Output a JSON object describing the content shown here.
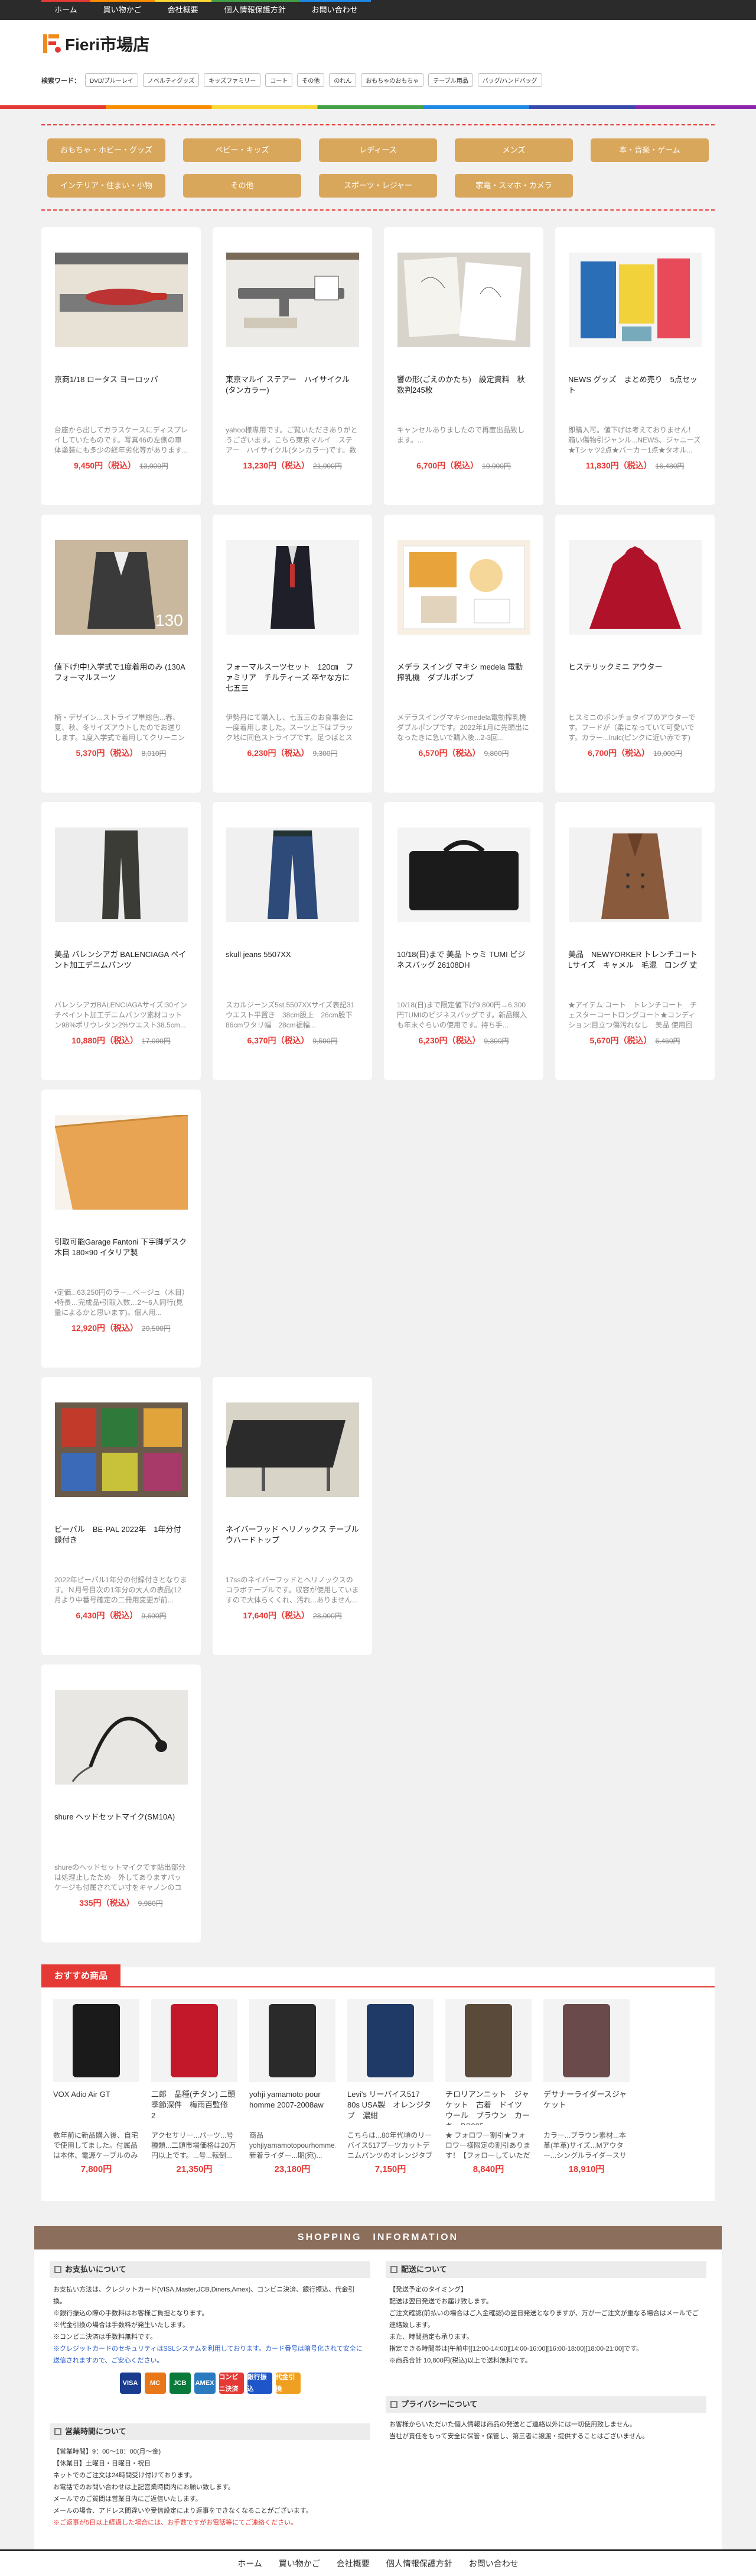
{
  "nav": {
    "items": [
      "ホーム",
      "買い物かご",
      "会社概要",
      "個人情報保護方針",
      "お問い合わせ"
    ],
    "colors": [
      "#e53935",
      "#fb8c00",
      "#fdd835",
      "#43a047",
      "#1e88e5"
    ]
  },
  "header": {
    "logo_text": "Fieri市場店",
    "keyword_label": "検索ワード：",
    "keywords": [
      "DVD/ブルーレイ",
      "ノベルティグッズ",
      "キッズファミリー",
      "コート",
      "その他",
      "のれん",
      "おもちゃのおもちゃ",
      "テーブル用品",
      "バッグ/ハンドバッグ"
    ]
  },
  "categories": [
    "おもちゃ・ホビー・グッズ",
    "ベビー・キッズ",
    "レディース",
    "メンズ",
    "本・音楽・ゲーム",
    "インテリア・住まい・小物",
    "その他",
    "スポーツ・レジャー",
    "家電・スマホ・カメラ"
  ],
  "products": [
    {
      "name": "京商1/18 ロータス ヨーロッパ",
      "desc": "台座から出してガラスケースにディスプレイしていたものです。写真46の左側の車体塗装にも多少の経年劣化等があります...",
      "price": "9,450円（税込）",
      "old": "13,000円",
      "img": "model-car",
      "c1": "#b33",
      "c2": "#e8e2d6"
    },
    {
      "name": "東京マルイ ステアー　ハイサイクル(タンカラー)",
      "desc": "yahoo様専用です。ご覧いただきありがとうございます。こちら東京マルイ　ステアー　ハイサイクル(タンカラー)です。数年...",
      "price": "13,230円（税込）",
      "old": "21,000円",
      "img": "airsoft",
      "c1": "#6b6b6b",
      "c2": "#eceae6"
    },
    {
      "name": "響の形(ごえのかたち)　設定資料　秋数判245枚",
      "desc": "キャンセルありましたので再度出品致します。...",
      "price": "6,700円（税込）",
      "old": "10,000円",
      "img": "papers",
      "c1": "#f5f3ee",
      "c2": "#d8d4cc"
    },
    {
      "name": "NEWS グッズ　まとめ売り　5点セット",
      "desc": "即購入可。値下げは考えておりません！箱い傷物引ジャンル...NEWS、ジャニーズ★Tシャツ2点★パーカー1点★タオル...",
      "price": "11,830円（税込）",
      "old": "16,480円",
      "img": "goods",
      "c1": "#2a6eb8",
      "c2": "#f2d23a"
    },
    {
      "name": "値下げ!中!入学式で1度着用のみ (130Aフォーマルスーツ",
      "desc": "柄・デザイン...ストライプ単総色...春、夏、秋、冬サイズアウトしたのでお送りします。1度入学式で着用してクリーニング済み...",
      "price": "5,370円（税込）",
      "old": "8,010円",
      "img": "suit-130",
      "c1": "#3a3a3a",
      "c2": "#c9b89e"
    },
    {
      "name": "フォーマルスーツセット　120㎝　ファミリア　チルティーズ 卒ヤな方に　七五三",
      "desc": "伊勢丹にて購入し、七五三のお食事会に一度着用しました。スーツ上下はブラック地に同色ストライプです。足つばとスーツ...",
      "price": "6,230円（税込）",
      "old": "9,300円",
      "img": "kids-suit",
      "c1": "#1f1f2a",
      "c2": "#f4f4f4"
    },
    {
      "name": "メデラ スイング マキシ medela 電動搾乳機　ダブルポンプ",
      "desc": "メデラスイングマキシmedela電動搾乳機　ダブルポンプです。2022年1月に先頭出になったきに急いで購入後...2-3回...",
      "price": "6,570円（税込）",
      "old": "9,800円",
      "img": "pump",
      "c1": "#e8a43a",
      "c2": "#f7efe2"
    },
    {
      "name": "ヒステリックミニ アウター",
      "desc": "ヒスミニのポンチョタイプのアウターです。フードが（柔になっていて可愛いです。カラー...lrulc(ピンクに近い赤です)",
      "price": "6,700円（税込）",
      "old": "10,000円",
      "img": "red-coat",
      "c1": "#b0122a",
      "c2": "#f4f4f4"
    },
    {
      "name": "美品 バレンシアガ BALENCIAGA ペイント加工デニムパンツ",
      "desc": "バレンシアガBALENCIAGAサイズ:30インチペイント加工デニムパンツ素材コットン98%ポリウレタン2%ウエスト38.5cm...",
      "price": "10,880円（税込）",
      "old": "17,000円",
      "img": "pants-dark",
      "c1": "#3c3c36",
      "c2": "#ededed"
    },
    {
      "name": "skull jeans 5507XX",
      "desc": "スカルジーンズ5st.5507XXサイズ表記31ウエスト平置き　38cm股上　26cm股下　86cmワタリ幅　28cm裾幅...",
      "price": "6,370円（税込）",
      "old": "9,500円",
      "img": "jeans",
      "c1": "#2e4a78",
      "c2": "#f0f0f0"
    },
    {
      "name": "10/18(日)まで 美品 トゥミ TUMI ビジネスバッグ 26108DH",
      "desc": "10/18(日)まで限定値下げ9,800円→6,300円TUMIのビジネスバッグです。新品購入も年末ぐらいの使用です。持ち手...",
      "price": "6,230円（税込）",
      "old": "9,300円",
      "img": "bag",
      "c1": "#1b1b1b",
      "c2": "#f3f3f3"
    },
    {
      "name": "美品　NEWYORKER トレンチコート Lサイズ　キャメル　毛混　ロング 丈",
      "desc": "★アイテム:コート　トレンチコート　チェスターコートロングコート★コンディション:目立つ傷汚れなし　美品 使用回数...",
      "price": "5,670円（税込）",
      "old": "6,460円",
      "img": "trench",
      "c1": "#8a5a3c",
      "c2": "#f2f2f2"
    },
    {
      "name": "引取可能Garage Fantoni 下宇脚デスク 木目 180×90 イタリア製",
      "desc": "•定価...63,250円のラー...ページュ（木目）•特長…完成品•引取入数…2〜6人同行(見量によるかと思います)。個人用...",
      "price": "12,920円（税込）",
      "old": "20,500円",
      "img": "desk",
      "c1": "#e8a452",
      "c2": "#f7f3ec"
    },
    {
      "name": "ビーパル　BE-PAL 2022年　1年分付録付き",
      "desc": "2022年ビーパル1年分の付録付きとなります。Ｎ月号目次の1年分の大人の表品(12月より中番号確定の二冊用変更が前...",
      "price": "6,430円（税込）",
      "old": "9,600円",
      "img": "magazines",
      "c1": "#c23a2a",
      "c2": "#2f7a3a"
    },
    {
      "name": "ネイバーフッド ヘリノックス テーブルウハードトップ",
      "desc": "17ssのネイバーフッドとヘリノックスのコラボテーブルです。収容が使用していますので大体らくくれ、汚れ...ありません...",
      "price": "17,640円（税込）",
      "old": "28,000円",
      "img": "table",
      "c1": "#2b2b2b",
      "c2": "#d8d4c8"
    },
    {
      "name": "shure ヘッドセットマイク(SM10A)",
      "desc": "shureのヘッドセットマイクです貼出部分は処理止したため　外してありますパッケージも付属されてい寸をキャノンのコード...",
      "price": "335円（税込）",
      "old": "9,980円",
      "img": "headset",
      "c1": "#1e1e1e",
      "c2": "#e9e7e3"
    }
  ],
  "reco": {
    "title": "おすすめ商品",
    "items": [
      {
        "name": "VOX Adio Air GT",
        "desc": "数年前に新品購入後、自宅で使用してました。付属品は本体、電源ケーブルのみです...",
        "price": "7,800円",
        "c1": "#1a1a1a"
      },
      {
        "name": "二郎　品種(チタン) 二頭季節深件　梅雨百監修　2",
        "desc": "アクセサリー...パーツ...号種類...二頭市場価格は20万円以上です。...号...転倒...セル...",
        "price": "21,350円",
        "c1": "#c2182a"
      },
      {
        "name": "yohji yamamoto pour homme 2007-2008aw",
        "desc": "商品yohjiyamamotopourhomme2008aw新着ライダー...期(宛)...",
        "price": "23,180円",
        "c1": "#2a2a2a"
      },
      {
        "name": "Levi's リーバイス517 80s USA製　オレンジタブ　濃紺",
        "desc": "こちらは...80年代頃のリーバイス517ブーツカットデニムパンツのオレンジタブモデル...",
        "price": "7,150円",
        "c1": "#1f3a66"
      },
      {
        "name": "チロリアンニット　ジャケット　古着　ドイツ　ウール　ブラウン　カーキ　BS385",
        "desc": "★ フォロワー割引★フォロワー様限定の割引あります！【フォローしていただければ...】",
        "price": "8,840円",
        "c1": "#5a4a3a"
      },
      {
        "name": "デサナーライダースジャケット",
        "desc": "カラー...ブラウン素材...本革(羊革)サイズ...Mアウター...シングルライダースサイ...",
        "price": "18,910円",
        "c1": "#6a4a4a"
      }
    ]
  },
  "info": {
    "bar_title": "SHOPPING　INFORMATION",
    "payment": {
      "title": "お支払いについて",
      "lines": [
        "お支払い方法は、クレジットカード(VISA,Master,JCB,Diners,Amex)、コンビニ決済、銀行振込、代金引換。",
        "※銀行振込の際の手数料はお客様ご負担となります。",
        "※代金引換の場合は手数料が発生いたします。",
        "※コンビニ決済は手数料無料です。"
      ],
      "warn": "※クレジットカードのセキュリティはSSLシステムを利用しております。カード番号は暗号化されて安全に送信されますので、ご安心ください。",
      "badges": [
        "VISA",
        "MC",
        "JCB",
        "AMEX",
        "コンビニ決済",
        "銀行振込",
        "代金引換"
      ],
      "badge_colors": [
        "#1a3c8f",
        "#e8771a",
        "#0a7a3a",
        "#2a7ac0",
        "#e53935",
        "#1e55c8",
        "#f0a020"
      ]
    },
    "delivery": {
      "title": "配送について",
      "lines": [
        "【発送予定のタイミング】",
        "配送は翌日発送でお届け致します。",
        "ご注文確認(前払いの場合はご入金確認)の翌日発送となりますが、万が一ご注文が重なる場合はメールでご連絡致します。",
        "また、時間指定も承ります。",
        "指定できる時間帯は[午前中][12:00-14:00][14:00-16:00][16:00-18:00][18:00-21:00]です。",
        "※商品合計 10,800円(税込)以上で送料無料です。"
      ]
    },
    "hours": {
      "title": "営業時間について",
      "lines": [
        "【営業時間】9：00〜18：00(月〜金)",
        "【休業日】土曜日・日曜日・祝日",
        "ネットでのご注文は24時間受け付けております。",
        "お電話でのお問い合わせは上記営業時間内にお願い致します。",
        "メールでのご質問は営業日内にご返信いたします。",
        "メールの場合、アドレス間違いや受信設定により返事をできなくなることがございます。"
      ],
      "warn": "※ご返事が5日以上経過した場合には、お手数ですがお電話等にてご連絡ください。"
    },
    "privacy": {
      "title": "プライバシーについて",
      "lines": [
        "お客様からいただいた個人情報は商品の発送とご連絡以外には一切使用致しません。",
        "当社が責任をもって安全に保管・保管し、第三者に譲渡・提供することはございません。"
      ]
    }
  },
  "footer": {
    "items": [
      "ホーム",
      "買い物かご",
      "会社概要",
      "個人情報保護方針",
      "お問い合わせ"
    ]
  }
}
